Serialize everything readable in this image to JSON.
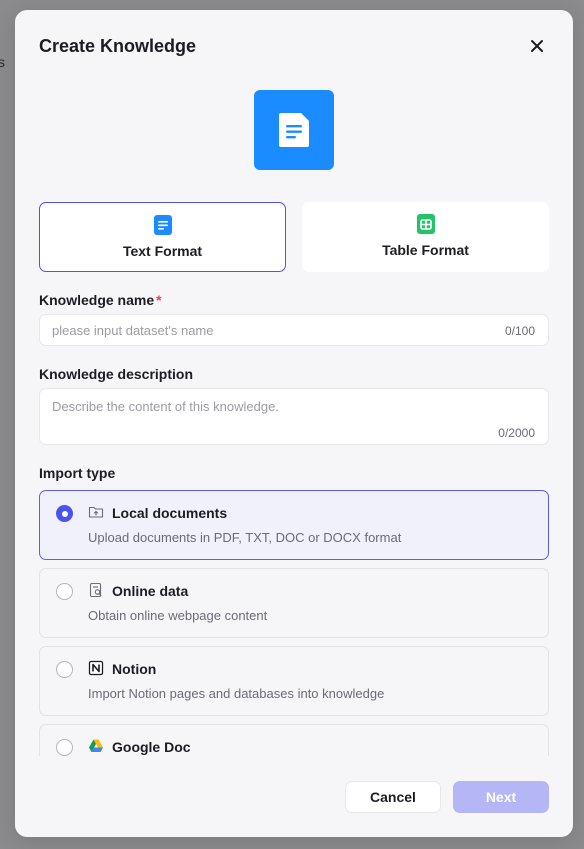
{
  "background": {
    "glyph": "s"
  },
  "modal": {
    "title": "Create Knowledge",
    "close_icon": "close-icon",
    "hero_icon": "document-icon"
  },
  "formats": [
    {
      "label": "Text Format",
      "icon": "text-document-icon",
      "color": "#1b8cff",
      "selected": true
    },
    {
      "label": "Table Format",
      "icon": "table-icon",
      "color": "#25c26a",
      "selected": false
    }
  ],
  "name_field": {
    "label": "Knowledge name",
    "required_mark": "*",
    "placeholder": "please input dataset's name",
    "counter": "0/100"
  },
  "description_field": {
    "label": "Knowledge description",
    "placeholder": "Describe the content of this knowledge.",
    "counter": "0/2000"
  },
  "import": {
    "label": "Import type",
    "options": [
      {
        "title": "Local documents",
        "desc": "Upload documents in PDF, TXT, DOC or DOCX format",
        "icon": "folder-upload-icon",
        "selected": true
      },
      {
        "title": "Online data",
        "desc": "Obtain online webpage content",
        "icon": "web-page-icon",
        "selected": false
      },
      {
        "title": "Notion",
        "desc": "Import Notion pages and databases into knowledge",
        "icon": "notion-icon",
        "selected": false
      },
      {
        "title": "Google Doc",
        "desc": "",
        "icon": "google-drive-icon",
        "selected": false
      }
    ]
  },
  "footer": {
    "cancel_label": "Cancel",
    "next_label": "Next"
  },
  "colors": {
    "accent": "#4d53e8",
    "next_disabled": "#b4b6f6",
    "required": "#f0424e"
  }
}
